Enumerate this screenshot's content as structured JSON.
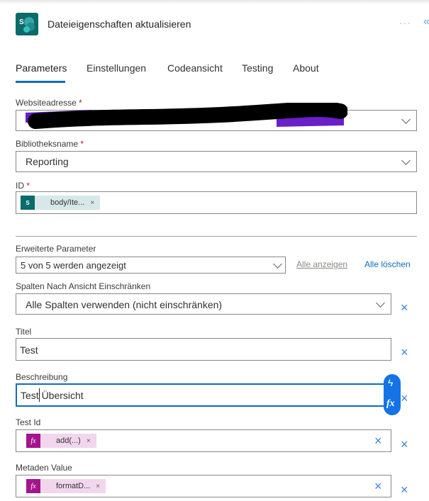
{
  "header": {
    "title": "Dateieigenschaften aktualisieren",
    "icon": "sharepoint-icon",
    "more_label": "···",
    "collapse_label": "«"
  },
  "tabs": [
    {
      "label": "Parameters",
      "active": true
    },
    {
      "label": "Einstellungen",
      "active": false
    },
    {
      "label": "Codeansicht",
      "active": false
    },
    {
      "label": "Testing",
      "active": false
    },
    {
      "label": "About",
      "active": false
    }
  ],
  "required_marker": "*",
  "fields": {
    "website": {
      "label": "Websiteadresse",
      "required": true,
      "value": ""
    },
    "library": {
      "label": "Bibliotheksname",
      "required": true,
      "value": "Reporting"
    },
    "id": {
      "label": "ID",
      "required": true,
      "token": {
        "text": "body/Ite...",
        "remove": "×",
        "icon": "sharepoint-icon"
      }
    }
  },
  "advanced": {
    "label": "Erweiterte Parameter",
    "selected": "5 von 5 werden angezeigt",
    "show_all": "Alle anzeigen",
    "clear_all": "Alle löschen"
  },
  "params": {
    "columns": {
      "label": "Spalten Nach Ansicht Einschränken",
      "value": "Alle Spalten verwenden (nicht einschränken)"
    },
    "title": {
      "label": "Titel",
      "value": "Test"
    },
    "description": {
      "label": "Beschreibung",
      "value": "Test Übersicht"
    },
    "test_id": {
      "label": "Test Id",
      "token": {
        "text": "add(...)",
        "remove": "×",
        "icon": "fx"
      }
    },
    "meta": {
      "label": "Metaden Value",
      "token": {
        "text": "formatD...",
        "remove": "×",
        "icon": "fx"
      }
    }
  },
  "icons": {
    "clear": "×",
    "bolt": "ϟ",
    "fx": "fx"
  },
  "colors": {
    "accent": "#0f6cbd",
    "sharepoint": "#0b6a6a",
    "fx_token": "#a4148c",
    "sp_token_bg": "#d6e8e8",
    "fx_token_bg": "#f1d6ee"
  }
}
